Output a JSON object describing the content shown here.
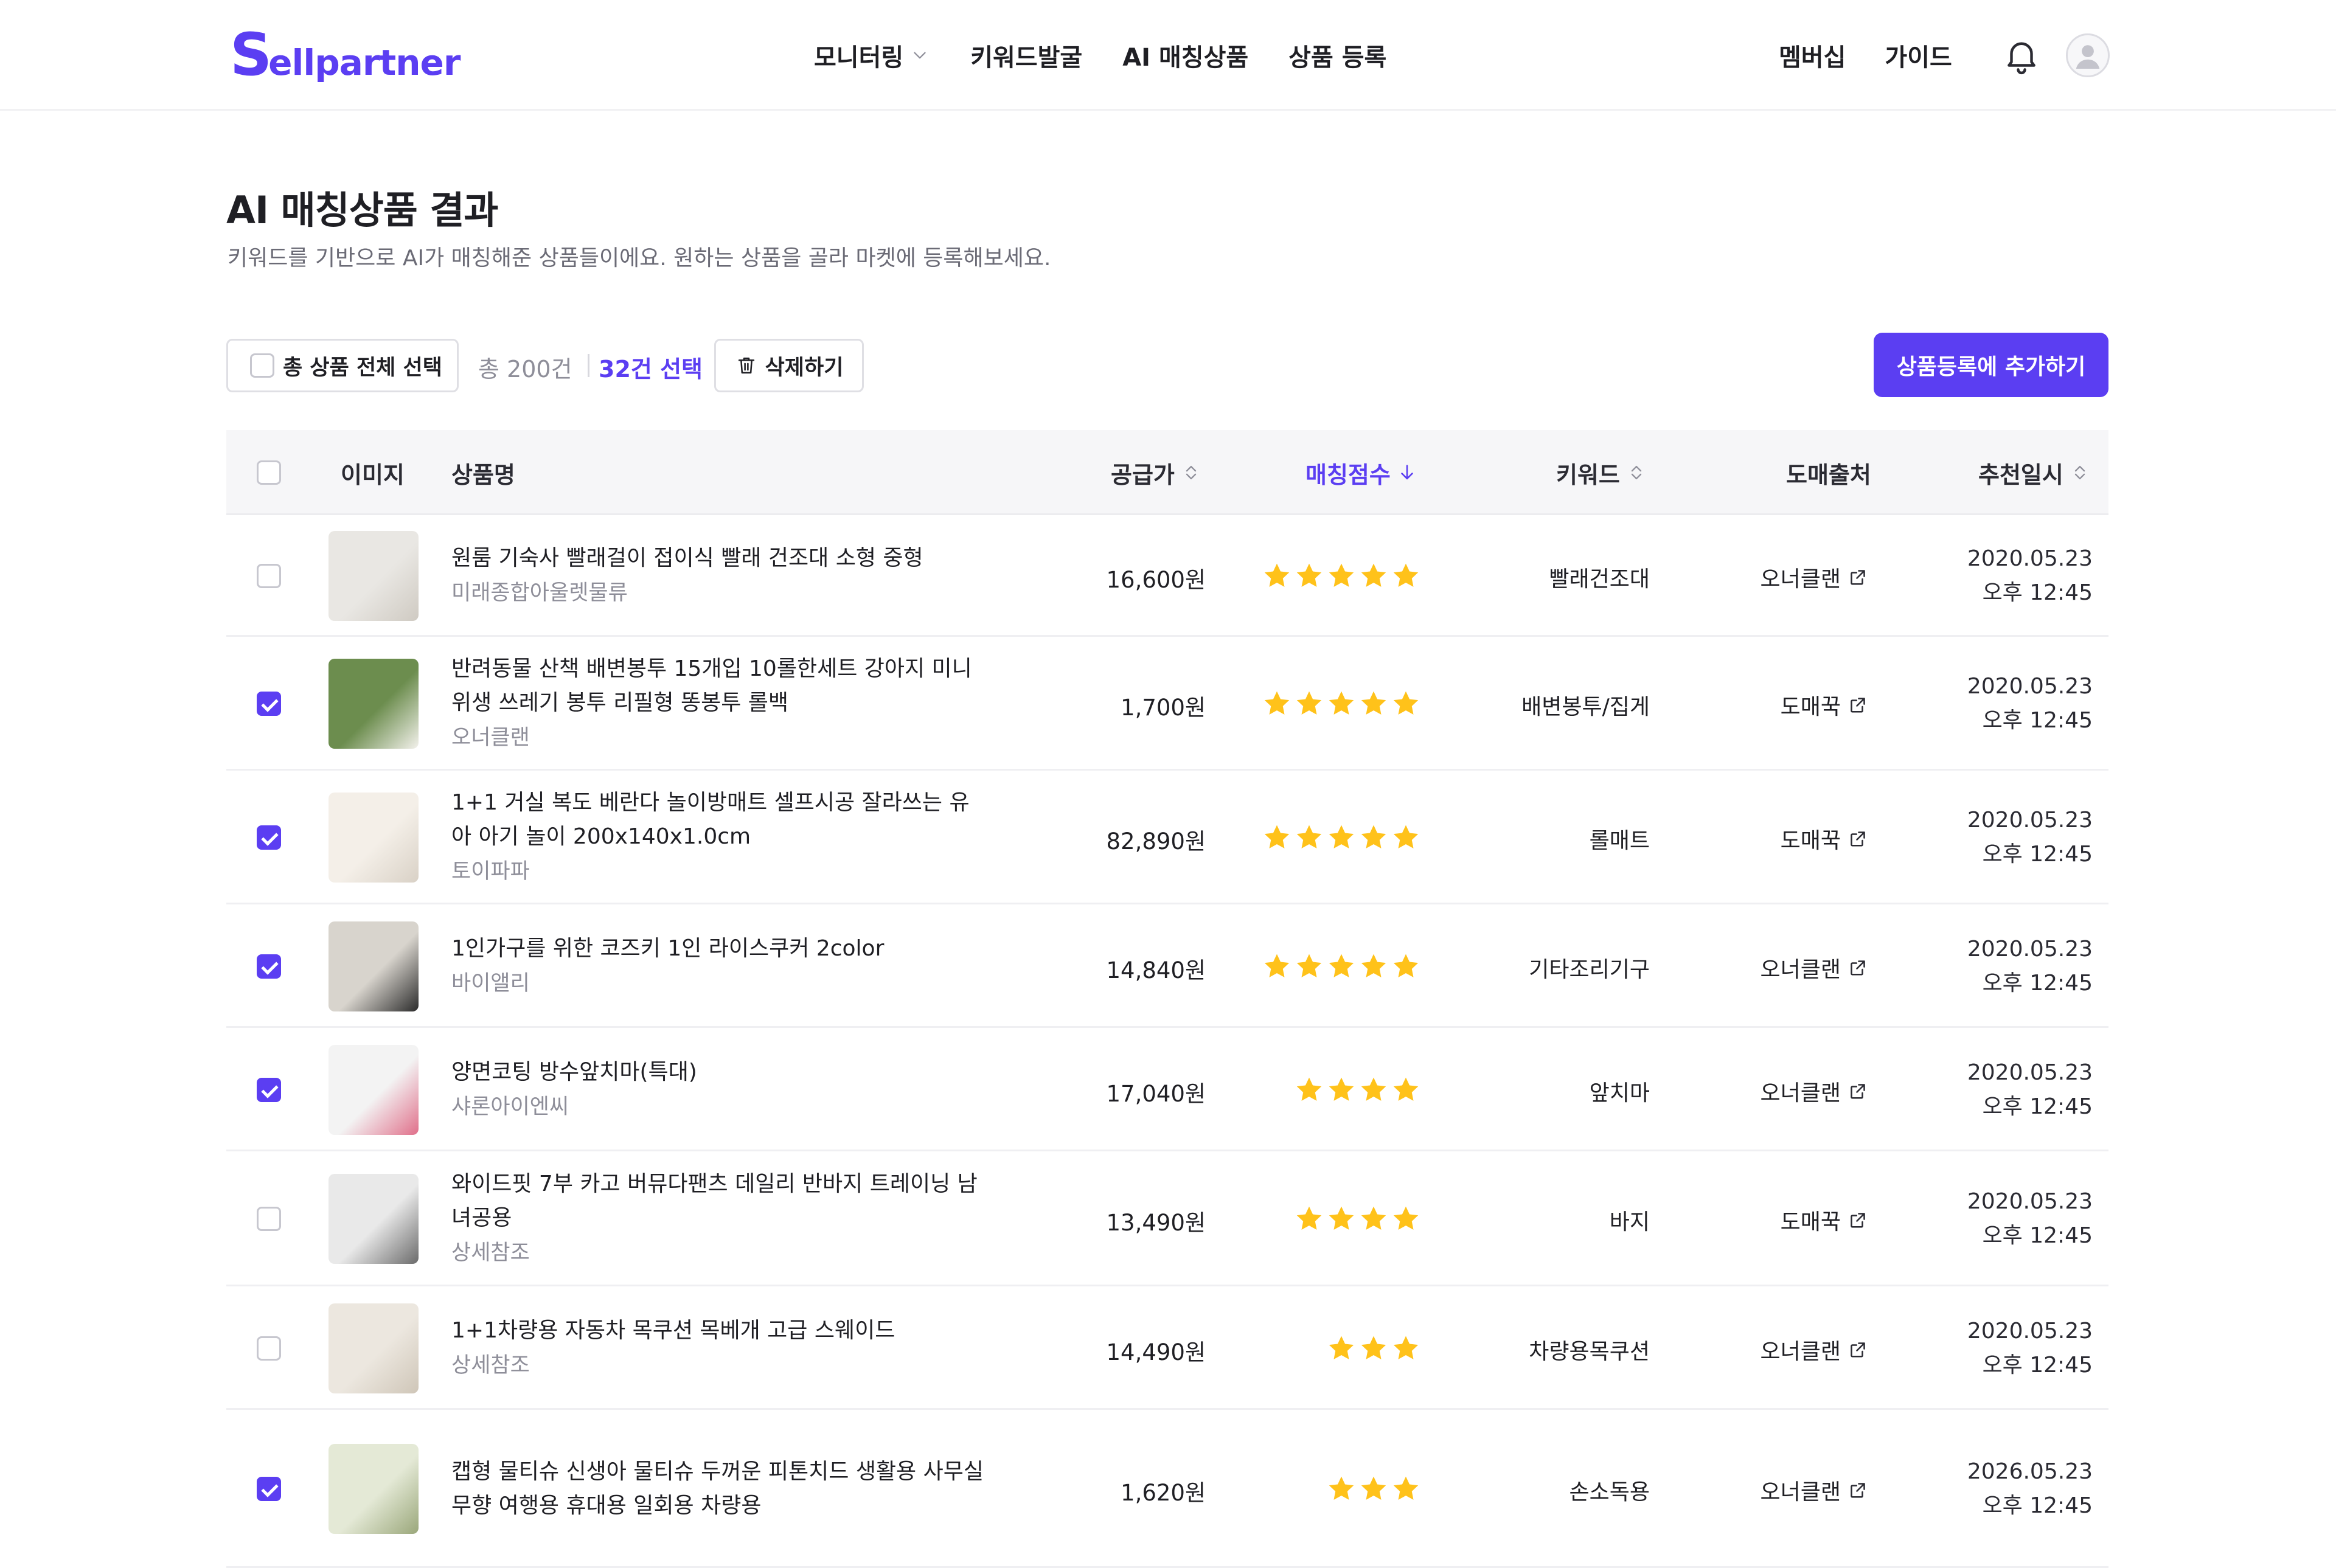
{
  "brand": {
    "logo_initial": "S",
    "logo_rest": "ellpartner",
    "accent": "#5b3ef2"
  },
  "nav": {
    "items": [
      "모니터링",
      "키워드발굴",
      "AI 매칭상품",
      "상품 등록"
    ],
    "right_items": [
      "멤버십",
      "가이드"
    ]
  },
  "page": {
    "title": "AI 매칭상품 결과",
    "subtitle": "키워드를 기반으로 AI가 매칭해준 상품들이에요. 원하는 상품을 골라 마켓에 등록해보세요."
  },
  "toolbar": {
    "select_all_label": "총 상품 전체 선택",
    "total_count": "총 200건",
    "selected_count": "32건 선택",
    "delete_label": "삭제하기",
    "add_label": "상품등록에 추가하기"
  },
  "table": {
    "columns": {
      "image": "이미지",
      "name": "상품명",
      "price": "공급가",
      "score": "매칭점수",
      "keyword": "키워드",
      "source": "도매출처",
      "date": "추천일시"
    },
    "rows": [
      {
        "checked": false,
        "name": "원룸 기숙사 빨래걸이 접이식 빨래 건조대 소형 중형",
        "seller": "미래종합아울렛물류",
        "price": "16,600원",
        "stars": 5,
        "keyword": "빨래건조대",
        "source": "오너클랜",
        "date": "2020.05.23",
        "time": "오후 12:45"
      },
      {
        "checked": true,
        "name": "반려동물 산책 배변봉투 15개입 10롤한세트 강아지 미니 위생 쓰레기 봉투 리필형 똥봉투 롤백",
        "seller": "오너클랜",
        "price": "1,700원",
        "stars": 5,
        "keyword": "배변봉투/집게",
        "source": "도매꾹",
        "date": "2020.05.23",
        "time": "오후 12:45"
      },
      {
        "checked": true,
        "name": "1+1 거실 복도 베란다 놀이방매트 셀프시공 잘라쓰는 유아 아기 놀이 200x140x1.0cm",
        "seller": "토이파파",
        "price": "82,890원",
        "stars": 5,
        "keyword": "롤매트",
        "source": "도매꾹",
        "date": "2020.05.23",
        "time": "오후 12:45"
      },
      {
        "checked": true,
        "name": "1인가구를 위한 코즈키 1인 라이스쿠커 2color",
        "seller": "바이앨리",
        "price": "14,840원",
        "stars": 5,
        "keyword": "기타조리기구",
        "source": "오너클랜",
        "date": "2020.05.23",
        "time": "오후 12:45"
      },
      {
        "checked": true,
        "name": "양면코팅 방수앞치마(특대)",
        "seller": "샤론아이엔씨",
        "price": "17,040원",
        "stars": 4,
        "keyword": "앞치마",
        "source": "오너클랜",
        "date": "2020.05.23",
        "time": "오후 12:45"
      },
      {
        "checked": false,
        "name": "와이드핏 7부 카고 버뮤다팬츠 데일리 반바지 트레이닝 남녀공용",
        "seller": "상세참조",
        "price": "13,490원",
        "stars": 4,
        "keyword": "바지",
        "source": "도매꾹",
        "date": "2020.05.23",
        "time": "오후 12:45"
      },
      {
        "checked": false,
        "name": "1+1차량용 자동차 목쿠션 목베개 고급 스웨이드",
        "seller": "상세참조",
        "price": "14,490원",
        "stars": 3,
        "keyword": "차량용목쿠션",
        "source": "오너클랜",
        "date": "2020.05.23",
        "time": "오후 12:45"
      },
      {
        "checked": true,
        "name": "캡형 물티슈 신생아 물티슈 두꺼운 피톤치드 생활용 사무실 무향 여행용 휴대용 일회용 차량용",
        "seller": "",
        "price": "1,620원",
        "stars": 3,
        "keyword": "손소독용",
        "source": "오너클랜",
        "date": "2026.05.23",
        "time": "오후 12:45"
      }
    ]
  },
  "colors": {
    "star": "#ffc21a",
    "text": "#1f1f24",
    "muted": "#8e8e99"
  }
}
